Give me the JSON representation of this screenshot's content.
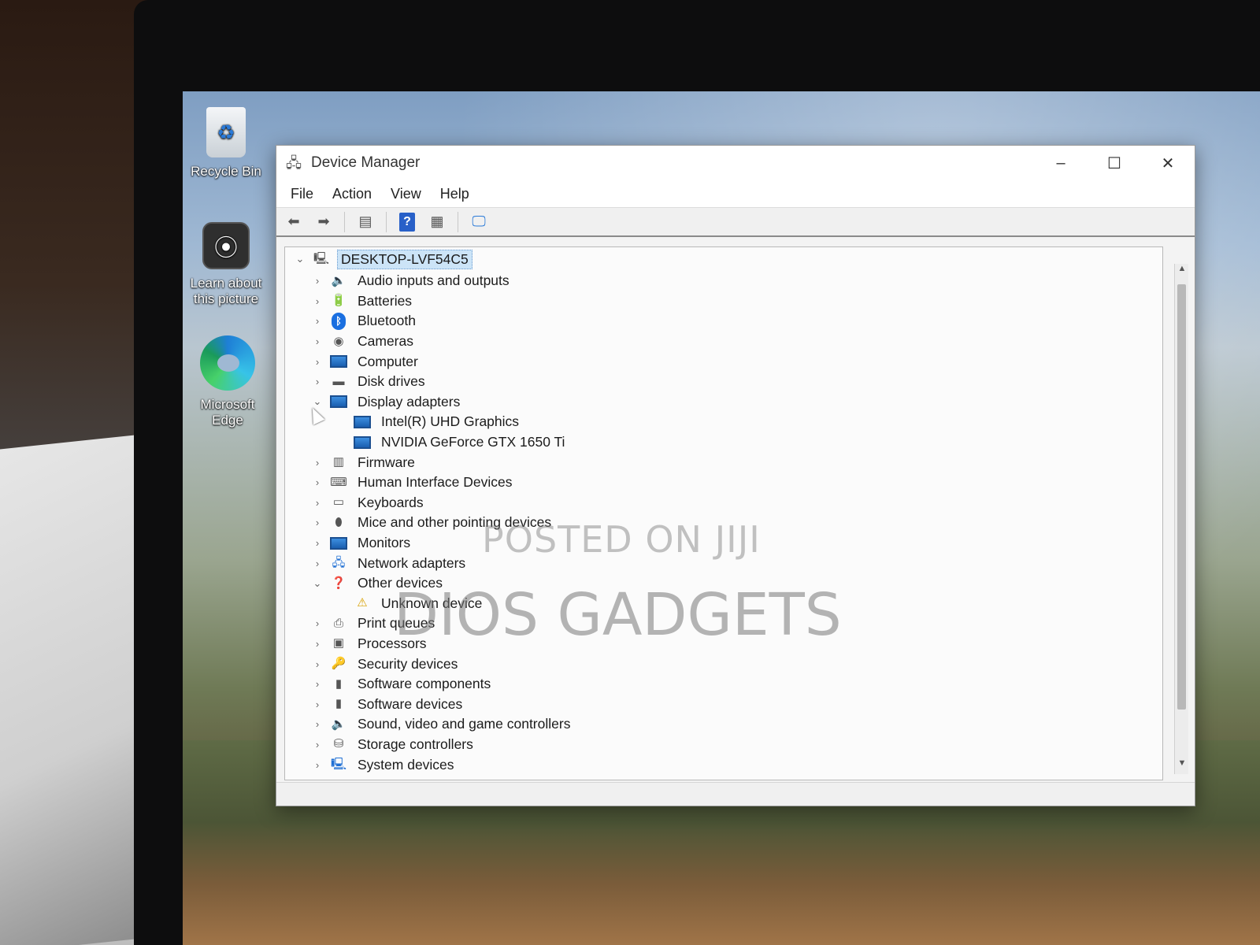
{
  "desktop": {
    "icons": [
      {
        "label": "Recycle Bin",
        "icon": "recycle-bin-icon"
      },
      {
        "label": "Learn about this picture",
        "icon": "learn-about-picture-icon"
      },
      {
        "label": "Microsoft Edge",
        "icon": "edge-icon"
      }
    ]
  },
  "window": {
    "title": "Device Manager",
    "title_icon": "device-manager-icon",
    "controls": {
      "minimize": "–",
      "maximize": "☐",
      "close": "✕"
    }
  },
  "menu": {
    "items": [
      "File",
      "Action",
      "View",
      "Help"
    ]
  },
  "toolbar": {
    "back": "⬅",
    "forward": "➡",
    "properties": "▤",
    "help": "?",
    "view": "▦",
    "scan": "🖵"
  },
  "tree": {
    "root": {
      "label": "DESKTOP-LVF54C5",
      "expanded": true
    },
    "categories": [
      {
        "label": "Audio inputs and outputs",
        "icon": "speaker-icon",
        "expanded": false
      },
      {
        "label": "Batteries",
        "icon": "battery-icon",
        "expanded": false
      },
      {
        "label": "Bluetooth",
        "icon": "bluetooth-icon",
        "expanded": false
      },
      {
        "label": "Cameras",
        "icon": "camera-icon",
        "expanded": false
      },
      {
        "label": "Computer",
        "icon": "monitor-icon",
        "expanded": false
      },
      {
        "label": "Disk drives",
        "icon": "disk-icon",
        "expanded": false
      },
      {
        "label": "Display adapters",
        "icon": "display-adapter-icon",
        "expanded": true,
        "children": [
          "Intel(R) UHD Graphics",
          "NVIDIA GeForce GTX 1650 Ti"
        ]
      },
      {
        "label": "Firmware",
        "icon": "firmware-icon",
        "expanded": false
      },
      {
        "label": "Human Interface Devices",
        "icon": "hid-icon",
        "expanded": false
      },
      {
        "label": "Keyboards",
        "icon": "keyboard-icon",
        "expanded": false
      },
      {
        "label": "Mice and other pointing devices",
        "icon": "mouse-icon",
        "expanded": false
      },
      {
        "label": "Monitors",
        "icon": "monitor-icon",
        "expanded": false
      },
      {
        "label": "Network adapters",
        "icon": "network-icon",
        "expanded": false
      },
      {
        "label": "Other devices",
        "icon": "other-devices-icon",
        "expanded": true,
        "children": [
          "Unknown device"
        ]
      },
      {
        "label": "Print queues",
        "icon": "printer-icon",
        "expanded": false
      },
      {
        "label": "Processors",
        "icon": "processor-icon",
        "expanded": false
      },
      {
        "label": "Security devices",
        "icon": "security-icon",
        "expanded": false
      },
      {
        "label": "Software components",
        "icon": "software-component-icon",
        "expanded": false
      },
      {
        "label": "Software devices",
        "icon": "software-device-icon",
        "expanded": false
      },
      {
        "label": "Sound, video and game controllers",
        "icon": "speaker-icon",
        "expanded": false
      },
      {
        "label": "Storage controllers",
        "icon": "storage-icon",
        "expanded": false
      },
      {
        "label": "System devices",
        "icon": "system-icon",
        "expanded": false
      }
    ]
  },
  "watermark": {
    "line1": "POSTED ON JIJI",
    "line2": "DIOS GADGETS"
  }
}
